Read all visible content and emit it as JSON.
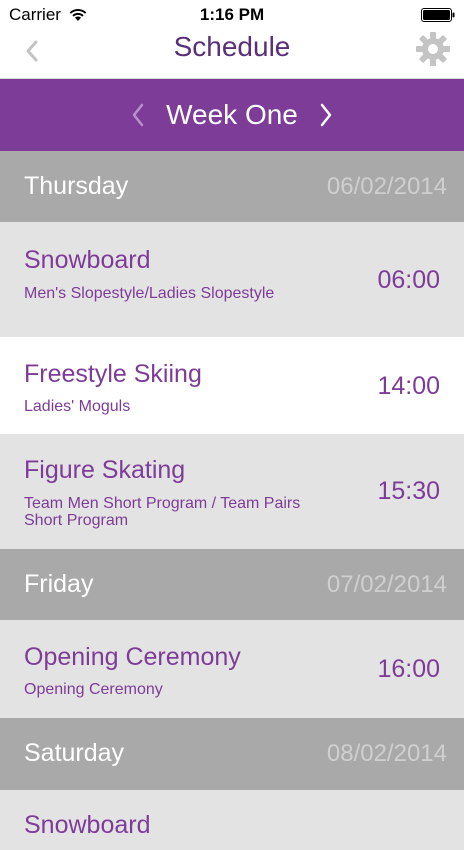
{
  "status_bar": {
    "carrier": "Carrier",
    "time": "1:16 PM"
  },
  "nav": {
    "title": "Schedule",
    "back_icon": "chevron-left-icon",
    "settings_icon": "gear-icon"
  },
  "week": {
    "label": "Week One",
    "prev_icon": "chevron-left-icon",
    "next_icon": "chevron-right-icon"
  },
  "days": [
    {
      "name": "Thursday",
      "date": "06/02/2014",
      "events": [
        {
          "sport": "Snowboard",
          "event": "Men's Slopestyle/Ladies Slopestyle",
          "time": "06:00"
        },
        {
          "sport": "Freestyle Skiing",
          "event": "Ladies' Moguls",
          "time": "14:00"
        },
        {
          "sport": "Figure Skating",
          "event": "Team Men Short Program / Team Pairs Short Program",
          "time": "15:30"
        }
      ]
    },
    {
      "name": "Friday",
      "date": "07/02/2014",
      "events": [
        {
          "sport": "Opening Ceremony",
          "event": "Opening Ceremony",
          "time": "16:00"
        }
      ]
    },
    {
      "name": "Saturday",
      "date": "08/02/2014",
      "events": [
        {
          "sport": "Snowboard"
        }
      ]
    }
  ],
  "colors": {
    "accent": "#7d3c98",
    "day_header": "#a9a9a9",
    "row_gray": "#e3e3e3",
    "row_white": "#ffffff"
  }
}
